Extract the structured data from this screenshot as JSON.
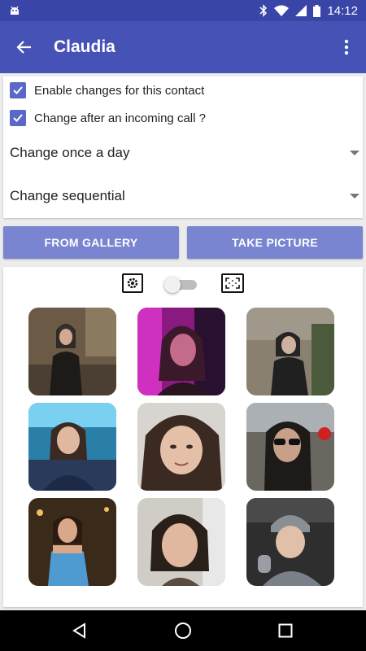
{
  "status_bar": {
    "time": "14:12"
  },
  "app_bar": {
    "title": "Claudia"
  },
  "options": {
    "enable_changes": {
      "label": "Enable changes for this contact",
      "checked": true
    },
    "change_after_call": {
      "label": "Change after an incoming call ?",
      "checked": true
    },
    "frequency": {
      "selected": "Change once a day"
    },
    "order": {
      "selected": "Change sequential"
    }
  },
  "buttons": {
    "from_gallery": "FROM GALLERY",
    "take_picture": "TAKE PICTURE"
  },
  "gallery": {
    "toggle_on": false,
    "photos": [
      {
        "bg": "#6b5a45",
        "accent": "#2a2420"
      },
      {
        "bg": "#b01fa0",
        "accent": "#3a1a2a"
      },
      {
        "bg": "#8a8070",
        "accent": "#252525"
      },
      {
        "bg": "#2a7fa8",
        "accent": "#3b2a22"
      },
      {
        "bg": "#d8d4cf",
        "accent": "#3a2a22"
      },
      {
        "bg": "#6a6660",
        "accent": "#1e1a18"
      },
      {
        "bg": "#3a2a1a",
        "accent": "#4f9ad0"
      },
      {
        "bg": "#d0ccc6",
        "accent": "#2a201a"
      },
      {
        "bg": "#2e2e2e",
        "accent": "#8a8f94"
      }
    ]
  },
  "colors": {
    "status_bar": "#3a45a8",
    "app_bar": "#4652b5",
    "accent": "#5a68c8",
    "button": "#7a85d2"
  }
}
